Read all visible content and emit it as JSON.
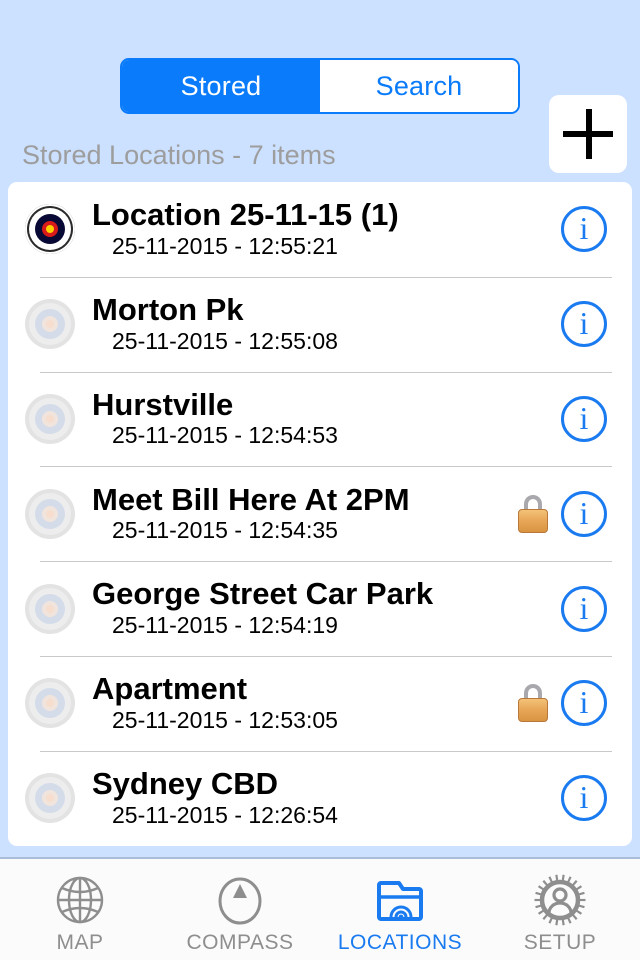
{
  "theme": {
    "background": "#cce0ff",
    "accent": "#0a7bfb",
    "card": "#ffffff",
    "muted_text": "#9d9d9d",
    "separator": "#c9c9c9"
  },
  "topbar": {
    "segments": [
      {
        "label": "Stored",
        "selected": true
      },
      {
        "label": "Search",
        "selected": false
      }
    ],
    "add_button": {
      "icon": "plus-icon"
    },
    "list_header": "Stored Locations - 7 items"
  },
  "list": {
    "items": [
      {
        "title": "Location 25-11-15 (1)",
        "timestamp": "25-11-2015 - 12:55:21",
        "selected": true,
        "locked": false,
        "info_label": "i"
      },
      {
        "title": "Morton Pk",
        "timestamp": "25-11-2015 - 12:55:08",
        "selected": false,
        "locked": false,
        "info_label": "i"
      },
      {
        "title": "Hurstville",
        "timestamp": "25-11-2015 - 12:54:53",
        "selected": false,
        "locked": false,
        "info_label": "i"
      },
      {
        "title": "Meet Bill Here At 2PM",
        "timestamp": "25-11-2015 - 12:54:35",
        "selected": false,
        "locked": true,
        "info_label": "i"
      },
      {
        "title": "George Street Car Park",
        "timestamp": "25-11-2015 - 12:54:19",
        "selected": false,
        "locked": false,
        "info_label": "i"
      },
      {
        "title": "Apartment",
        "timestamp": "25-11-2015 - 12:53:05",
        "selected": false,
        "locked": true,
        "info_label": "i"
      },
      {
        "title": "Sydney CBD",
        "timestamp": "25-11-2015 - 12:26:54",
        "selected": false,
        "locked": false,
        "info_label": "i"
      }
    ]
  },
  "tabbar": {
    "items": [
      {
        "label": "MAP",
        "icon": "globe-icon",
        "active": false
      },
      {
        "label": "COMPASS",
        "icon": "compass-icon",
        "active": false
      },
      {
        "label": "LOCATIONS",
        "icon": "folder-radar-icon",
        "active": true
      },
      {
        "label": "SETUP",
        "icon": "gear-person-icon",
        "active": false
      }
    ]
  }
}
